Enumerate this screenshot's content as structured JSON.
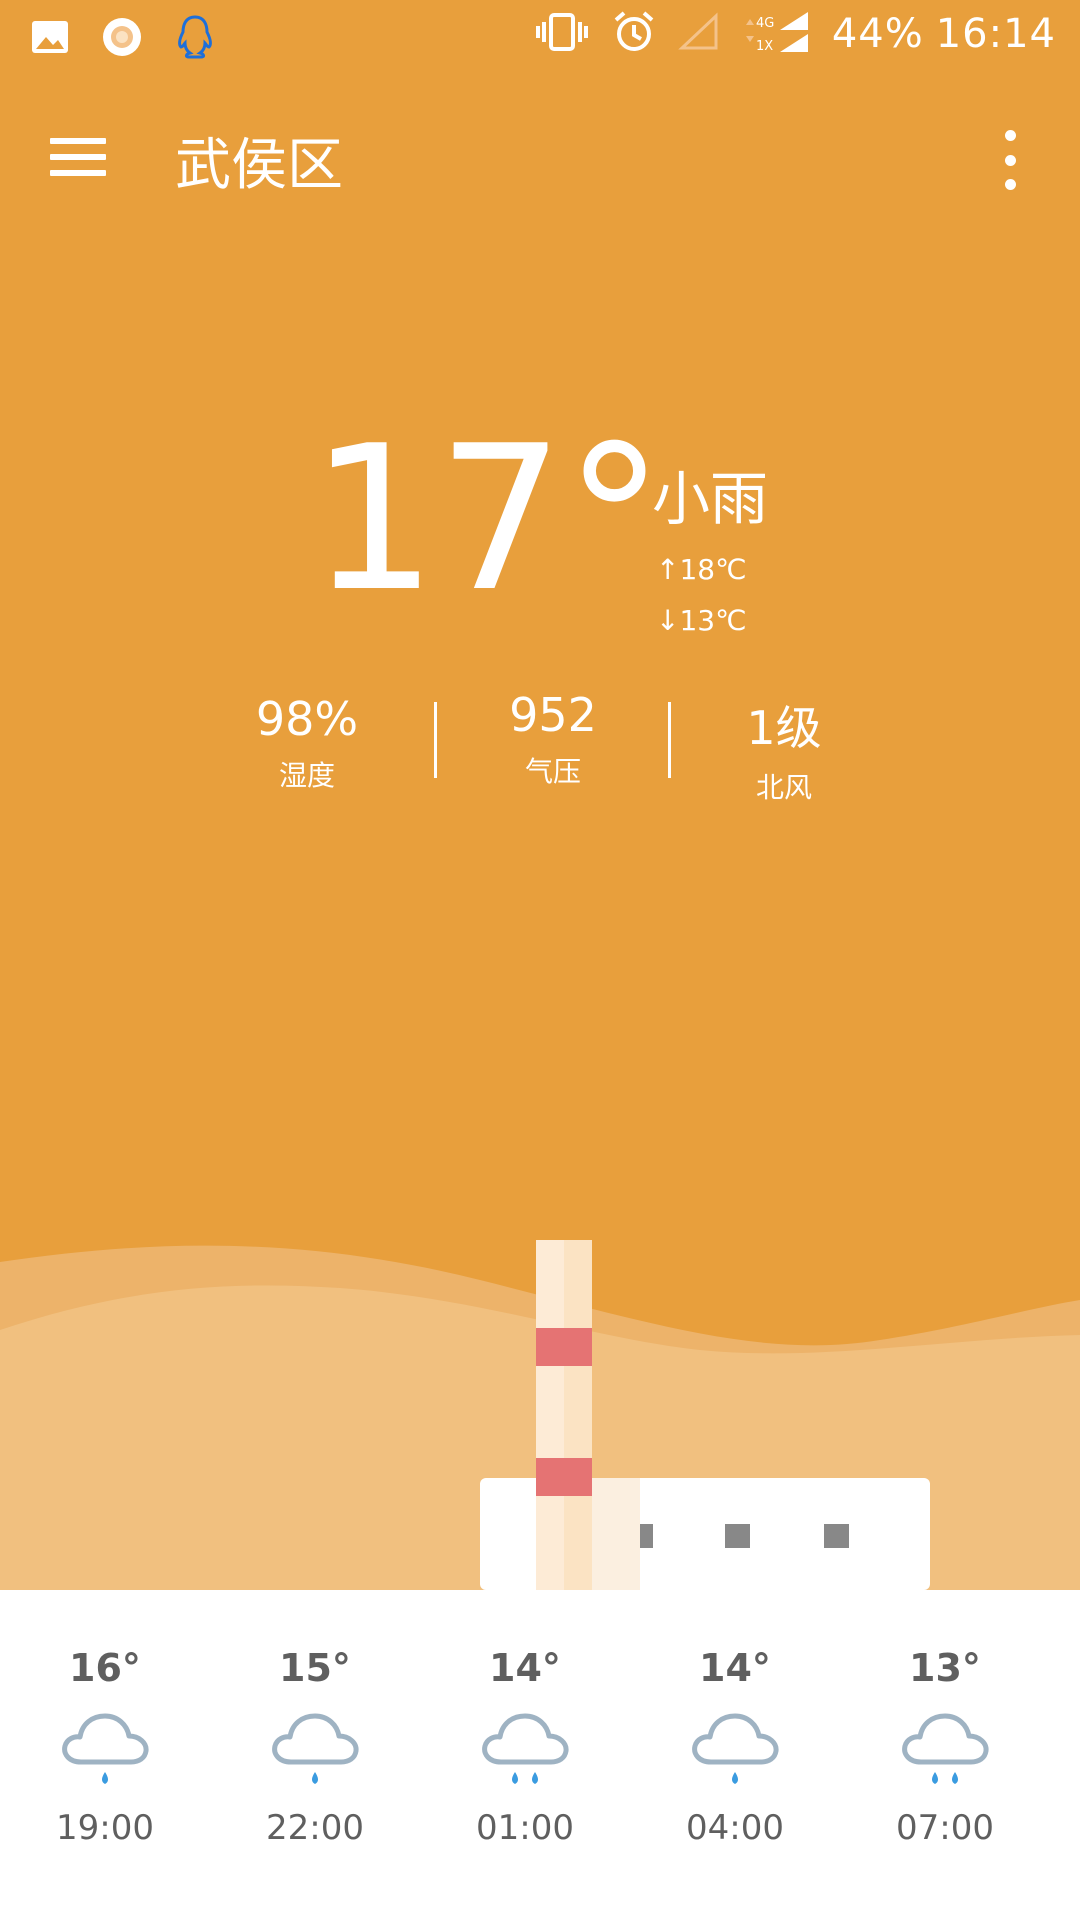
{
  "status_bar": {
    "battery": "44%",
    "time": "16:14",
    "network": "4G 1X"
  },
  "app_bar": {
    "title": "武侯区"
  },
  "current": {
    "temperature": "17°",
    "condition": "小雨",
    "high": "↑18℃",
    "low": "↓13℃"
  },
  "stats": {
    "humidity": {
      "value": "98%",
      "label": "湿度"
    },
    "pressure": {
      "value": "952",
      "label": "气压"
    },
    "wind": {
      "value": "1级",
      "label": "北风"
    }
  },
  "forecast": [
    {
      "temp": "16°",
      "time": "19:00",
      "icon": "light-rain-icon"
    },
    {
      "temp": "15°",
      "time": "22:00",
      "icon": "light-rain-icon"
    },
    {
      "temp": "14°",
      "time": "01:00",
      "icon": "moderate-rain-icon"
    },
    {
      "temp": "14°",
      "time": "04:00",
      "icon": "light-rain-icon"
    },
    {
      "temp": "13°",
      "time": "07:00",
      "icon": "moderate-rain-icon"
    }
  ],
  "colors": {
    "sky": "#E89F3C",
    "forecast_text": "#5f5f5f",
    "cloud_outline": "#9FB3C3",
    "rain_drop": "#3A9BE0",
    "chimney_red": "#E57373"
  }
}
